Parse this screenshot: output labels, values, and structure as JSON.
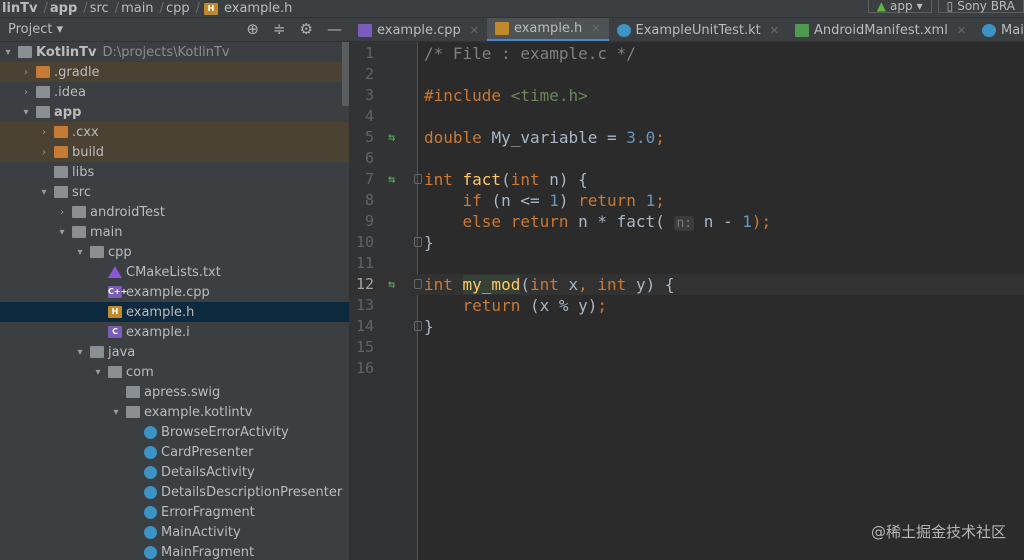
{
  "breadcrumb": [
    "linTv",
    "app",
    "src",
    "main",
    "cpp",
    "example.h"
  ],
  "run": {
    "config": "app",
    "device": "Sony BRA"
  },
  "panel": {
    "title": "Project"
  },
  "tree": [
    {
      "label": "KotlinTv",
      "path": "D:\\projects\\KotlinTv",
      "level": 0,
      "arrow": "▾",
      "icon": "folder",
      "bold": true
    },
    {
      "label": ".gradle",
      "level": 1,
      "arrow": "›",
      "icon": "ofolder",
      "ex": true
    },
    {
      "label": ".idea",
      "level": 1,
      "arrow": "›",
      "icon": "folder"
    },
    {
      "label": "app",
      "level": 1,
      "arrow": "▾",
      "icon": "folder",
      "bold": true
    },
    {
      "label": ".cxx",
      "level": 2,
      "arrow": "›",
      "icon": "ofolder",
      "ex": true
    },
    {
      "label": "build",
      "level": 2,
      "arrow": "›",
      "icon": "ofolder",
      "ex": true
    },
    {
      "label": "libs",
      "level": 2,
      "arrow": "",
      "icon": "folder"
    },
    {
      "label": "src",
      "level": 2,
      "arrow": "▾",
      "icon": "folder"
    },
    {
      "label": "androidTest",
      "level": 3,
      "arrow": "›",
      "icon": "folder"
    },
    {
      "label": "main",
      "level": 3,
      "arrow": "▾",
      "icon": "folder"
    },
    {
      "label": "cpp",
      "level": 4,
      "arrow": "▾",
      "icon": "folder"
    },
    {
      "label": "CMakeLists.txt",
      "level": 5,
      "arrow": "",
      "icon": "cmake"
    },
    {
      "label": "example.cpp",
      "level": 5,
      "arrow": "",
      "icon": "cpp"
    },
    {
      "label": "example.h",
      "level": 5,
      "arrow": "",
      "icon": "hfile",
      "sel": true
    },
    {
      "label": "example.i",
      "level": 5,
      "arrow": "",
      "icon": "ifile"
    },
    {
      "label": "java",
      "level": 4,
      "arrow": "▾",
      "icon": "folder"
    },
    {
      "label": "com",
      "level": 5,
      "arrow": "▾",
      "icon": "folder"
    },
    {
      "label": "apress.swig",
      "level": 6,
      "arrow": "",
      "icon": "folder"
    },
    {
      "label": "example.kotlintv",
      "level": 6,
      "arrow": "▾",
      "icon": "folder"
    },
    {
      "label": "BrowseErrorActivity",
      "level": 7,
      "arrow": "",
      "icon": "cls"
    },
    {
      "label": "CardPresenter",
      "level": 7,
      "arrow": "",
      "icon": "cls"
    },
    {
      "label": "DetailsActivity",
      "level": 7,
      "arrow": "",
      "icon": "cls"
    },
    {
      "label": "DetailsDescriptionPresenter",
      "level": 7,
      "arrow": "",
      "icon": "cls"
    },
    {
      "label": "ErrorFragment",
      "level": 7,
      "arrow": "",
      "icon": "cls"
    },
    {
      "label": "MainActivity",
      "level": 7,
      "arrow": "",
      "icon": "cls"
    },
    {
      "label": "MainFragment",
      "level": 7,
      "arrow": "",
      "icon": "cls"
    }
  ],
  "tabs": [
    {
      "label": "example.cpp",
      "icon": "cpp",
      "badge": "C++"
    },
    {
      "label": "example.h",
      "icon": "hfile",
      "badge": "H",
      "active": true
    },
    {
      "label": "ExampleUnitTest.kt",
      "icon": "cls",
      "badge": ""
    },
    {
      "label": "AndroidManifest.xml",
      "icon": "mf",
      "badge": "MF"
    },
    {
      "label": "MainFragment",
      "icon": "cls",
      "badge": ""
    }
  ],
  "code": [
    {
      "n": "1",
      "t": [
        [
          "/* File : example.c */",
          "cm"
        ]
      ]
    },
    {
      "n": "2",
      "t": []
    },
    {
      "n": "3",
      "t": [
        [
          "#include ",
          "kw"
        ],
        [
          "<time.h>",
          "str"
        ]
      ]
    },
    {
      "n": "4",
      "t": []
    },
    {
      "n": "5",
      "g": true,
      "t": [
        [
          "double ",
          "kw"
        ],
        [
          "My_variable = ",
          "pl"
        ],
        [
          "3.0",
          "num"
        ],
        [
          ";",
          "kw"
        ]
      ]
    },
    {
      "n": "6",
      "t": []
    },
    {
      "n": "7",
      "g": true,
      "f": true,
      "t": [
        [
          "int ",
          "kw"
        ],
        [
          "fact",
          "fn"
        ],
        [
          "(",
          "pl"
        ],
        [
          "int ",
          "kw"
        ],
        [
          "n) {",
          "pl"
        ]
      ]
    },
    {
      "n": "8",
      "t": [
        [
          "    if ",
          "kw"
        ],
        [
          "(n <= ",
          "pl"
        ],
        [
          "1",
          "num"
        ],
        [
          ") ",
          "pl"
        ],
        [
          "return ",
          "kw"
        ],
        [
          "1",
          "num"
        ],
        [
          ";",
          "kw"
        ]
      ]
    },
    {
      "n": "9",
      "t": [
        [
          "    else return ",
          "kw"
        ],
        [
          "n * fact( ",
          "pl"
        ],
        [
          "n:",
          "hint"
        ],
        [
          " n - ",
          "pl"
        ],
        [
          "1",
          "num"
        ],
        [
          ");",
          "kw"
        ]
      ]
    },
    {
      "n": "10",
      "f": true,
      "t": [
        [
          "}",
          "pl"
        ]
      ]
    },
    {
      "n": "11",
      "t": []
    },
    {
      "n": "12",
      "g": true,
      "f": true,
      "cur": true,
      "t": [
        [
          "int ",
          "kw"
        ],
        [
          "my_mod",
          "fn hl"
        ],
        [
          "(",
          "pl"
        ],
        [
          "int ",
          "kw"
        ],
        [
          "x",
          "pl"
        ],
        [
          ", ",
          "kw"
        ],
        [
          "int ",
          "kw"
        ],
        [
          "y) {",
          "pl"
        ]
      ]
    },
    {
      "n": "13",
      "t": [
        [
          "    return ",
          "kw"
        ],
        [
          "(x % y)",
          "pl"
        ],
        [
          ";",
          "kw"
        ]
      ]
    },
    {
      "n": "14",
      "f": true,
      "t": [
        [
          "}",
          "pl"
        ]
      ]
    },
    {
      "n": "15",
      "t": []
    },
    {
      "n": "16",
      "t": []
    }
  ],
  "watermark": "@稀土掘金技术社区"
}
